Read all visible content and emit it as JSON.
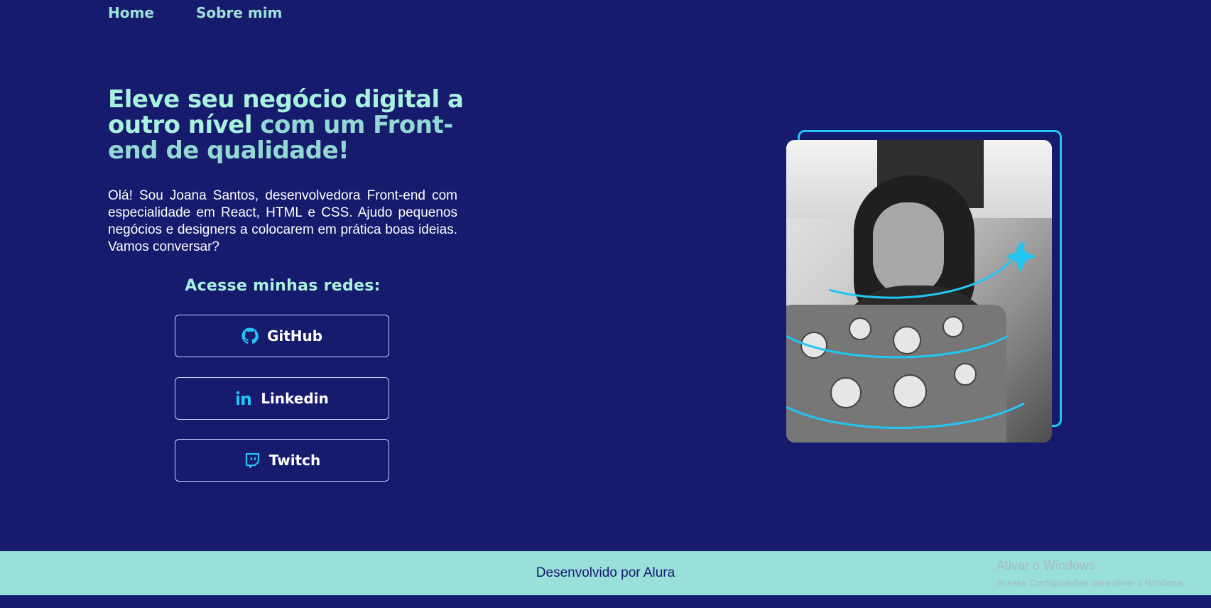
{
  "nav": {
    "items": [
      {
        "label": "Home"
      },
      {
        "label": "Sobre mim"
      }
    ]
  },
  "hero": {
    "headline_part1": "Eleve seu negócio digital a outro nível ",
    "headline_part2": "com um Front-end de qualidade!",
    "intro": "Olá! Sou Joana Santos, desenvolvedora Front-end com especialidade em React, HTML e CSS. Ajudo pequenos negócios e designers a colocarem em prática boas ideias. Vamos conversar?",
    "social_title": "Acesse minhas redes:",
    "buttons": [
      {
        "label": "GitHub",
        "icon": "github-icon"
      },
      {
        "label": "Linkedin",
        "icon": "linkedin-icon"
      },
      {
        "label": "Twitch",
        "icon": "twitch-icon"
      }
    ]
  },
  "image": {
    "description_icon": "profile-photo"
  },
  "footer": {
    "text": "Desenvolvido por Alura"
  },
  "watermark": {
    "line1": "Ativar o Windows",
    "line2": "Acesse Configurações para ativar o Windows."
  },
  "colors": {
    "background": "#161b6e",
    "accent": "#a9f2dd",
    "accent_alt": "#93d9d3",
    "icon": "#22c6f2",
    "footer": "#99dfda"
  }
}
